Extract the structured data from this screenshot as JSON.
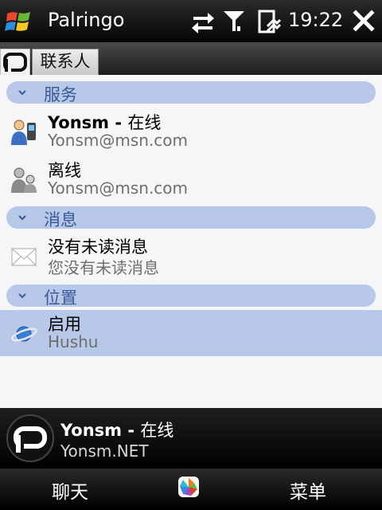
{
  "titlebar": {
    "app_title": "Palringo",
    "time": "19:22"
  },
  "tabs": [
    {
      "label": "P"
    },
    {
      "label": "联系人"
    }
  ],
  "sections": [
    {
      "header": "服务",
      "items": [
        {
          "title_bold": "Yonsm",
          "title_sep": " - ",
          "title_rest": "在线",
          "subtitle": "Yonsm@msn.com",
          "icon": "online-contact-icon"
        },
        {
          "title": "离线",
          "subtitle": "Yonsm@msn.com",
          "icon": "offline-contact-icon"
        }
      ]
    },
    {
      "header": "消息",
      "items": [
        {
          "title": "没有未读消息",
          "subtitle": "您没有未读消息",
          "icon": "envelope-icon"
        }
      ]
    },
    {
      "header": "位置",
      "items": [
        {
          "title": "启用",
          "subtitle": "Hushu",
          "icon": "planet-icon",
          "selected": true
        }
      ]
    }
  ],
  "profile": {
    "name": "Yonsm",
    "sep": " - ",
    "presence": "在线",
    "status": "Yonsm.NET"
  },
  "softkeys": {
    "left": "聊天",
    "right": "菜单"
  },
  "colors": {
    "section_bg": "#b7c8e8",
    "section_text": "#3a5a96",
    "selected_row": "#b7c8e8"
  }
}
